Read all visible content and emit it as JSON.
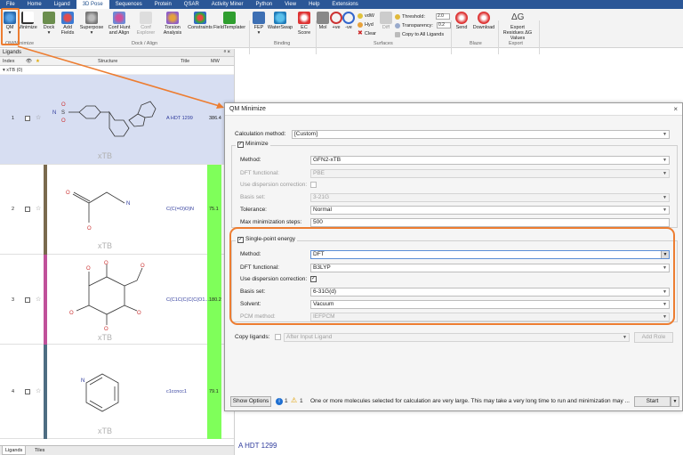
{
  "menu_tabs": [
    "File",
    "Home",
    "Ligand",
    "3D Pose",
    "Sequences",
    "Protein",
    "QSAR",
    "Activity Miner",
    "Python",
    "View",
    "Help",
    "Extensions"
  ],
  "active_menu_tab": "3D Pose",
  "ribbon": {
    "qm": "QM",
    "minimize": "Minimize",
    "dock": "Dock",
    "add_fields": "Add Fields",
    "superpose": "Superpose",
    "conf_hunt": "Conf Hunt and Align",
    "conf_explorer": "Conf Explorer",
    "torsion": "Torsion Analysis",
    "constraints": "Constraints",
    "fieldtemplater": "FieldTemplater",
    "fep": "FEP",
    "waterswap": "WaterSwap",
    "ec_score": "EC Score",
    "mol": "Mol",
    "plus_ve": "+ve",
    "minus_ve": "-ve",
    "vdw": "vdW",
    "hyd": "Hyd",
    "clear": "Clear",
    "diff": "Diff",
    "threshold_label": "Threshold:",
    "threshold_value": "2.0",
    "transparency_label": "Transparency:",
    "transparency_value": "0.2",
    "copy_all": "Copy to All Ligands",
    "send": "Send",
    "download": "Download",
    "export": "Export Residues ΔG Values",
    "groups": {
      "qm": "QM/Minimize",
      "dock": "Dock / Align",
      "binding": "Binding",
      "surfaces": "Surfaces",
      "blaze": "Blaze",
      "export": "Export"
    }
  },
  "ligands": {
    "panel_title": "Ligands",
    "pin": "ᵃ ×",
    "headers": {
      "index": "Index",
      "visible": "👁",
      "star": "★",
      "structure": "Structure",
      "title": "Title",
      "mw": "MW"
    },
    "group": "▾ xTB (0)",
    "rows": [
      {
        "index": "1",
        "title": "A HDT 1299",
        "mw": "386.4",
        "label": "xTB",
        "color": "#cfd6ee"
      },
      {
        "index": "2",
        "title": "C(C(=O)O)N",
        "mw": "75.1",
        "label": "xTB",
        "color": "#7a6a4e"
      },
      {
        "index": "3",
        "title": "C(C1C(C(C(C(O1...",
        "mw": "180.2",
        "label": "xTB",
        "color": "#c0509a"
      },
      {
        "index": "4",
        "title": "c1ccncc1",
        "mw": "79.1",
        "label": "xTB",
        "color": "#4e6d82"
      }
    ],
    "tabs": [
      "Ligands",
      "Tiles"
    ],
    "mw_bar_color": "#7fff5a"
  },
  "right_panel": {
    "bottom_title": "A HDT 1299"
  },
  "dialog": {
    "title": "QM Minimize",
    "close": "×",
    "calculation_method_label": "Calculation method:",
    "calculation_method_value": "[Custom]",
    "minimize": {
      "legend": "Minimize",
      "checked": true,
      "method_label": "Method:",
      "method_value": "GFN2-xTB",
      "dft_functional_label": "DFT functional:",
      "dft_functional_value": "PBE",
      "dispersion_label": "Use dispersion correction:",
      "basis_set_label": "Basis set:",
      "basis_set_value": "3-21G",
      "tolerance_label": "Tolerance:",
      "tolerance_value": "Normal",
      "max_steps_label": "Max minimization steps:",
      "max_steps_value": "500"
    },
    "single_point": {
      "legend": "Single-point energy",
      "checked": true,
      "method_label": "Method:",
      "method_value": "DFT",
      "dft_functional_label": "DFT functional:",
      "dft_functional_value": "B3LYP",
      "dispersion_label": "Use dispersion correction:",
      "dispersion_checked": true,
      "basis_set_label": "Basis set:",
      "basis_set_value": "6-31G(d)",
      "solvent_label": "Solvent:",
      "solvent_value": "Vacuum",
      "pcm_label": "PCM method:",
      "pcm_value": "IEFPCM"
    },
    "copy_ligands_label": "Copy ligands:",
    "copy_ligands_value": "After Input Ligand",
    "add_role": "Add Role",
    "show_options": "Show Options",
    "info_count": "1",
    "warn_count": "1",
    "message": "One or more molecules selected for calculation are very large. This may take a very long time to run and minimization may ...",
    "start": "Start"
  },
  "accent_color": "#ed7d31"
}
